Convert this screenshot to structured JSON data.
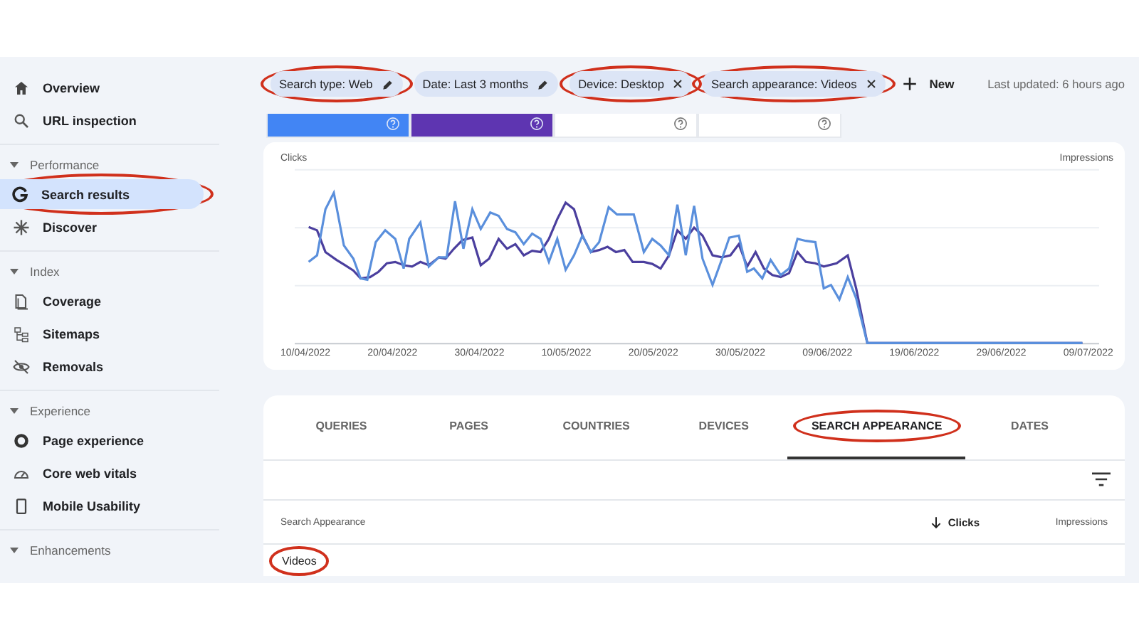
{
  "sidebar": {
    "top_items": [
      {
        "label": "Overview",
        "kind": "home",
        "selected": false,
        "circled": false
      },
      {
        "label": "URL inspection",
        "kind": "search",
        "selected": false,
        "circled": false
      }
    ],
    "sections": [
      {
        "title": "Performance",
        "expanded": true,
        "items": [
          {
            "label": "Search results",
            "kind": "google",
            "selected": true,
            "circled": true
          },
          {
            "label": "Discover",
            "kind": "asterisk",
            "selected": false,
            "circled": false
          }
        ]
      },
      {
        "title": "Index",
        "expanded": true,
        "items": [
          {
            "label": "Coverage",
            "kind": "pages",
            "selected": false,
            "circled": false
          },
          {
            "label": "Sitemaps",
            "kind": "sitemap",
            "selected": false,
            "circled": false
          },
          {
            "label": "Removals",
            "kind": "eyeoff",
            "selected": false,
            "circled": false
          }
        ]
      },
      {
        "title": "Experience",
        "expanded": true,
        "items": [
          {
            "label": "Page experience",
            "kind": "ring",
            "selected": false,
            "circled": false
          },
          {
            "label": "Core web vitals",
            "kind": "gauge",
            "selected": false,
            "circled": false
          },
          {
            "label": "Mobile Usability",
            "kind": "phone",
            "selected": false,
            "circled": false
          }
        ]
      },
      {
        "title": "Enhancements",
        "expanded": true
      }
    ]
  },
  "filters": {
    "chips": [
      {
        "label": "Search type: Web",
        "kind": "edit",
        "circled": true
      },
      {
        "label": "Date: Last 3 months",
        "kind": "edit",
        "circled": false
      },
      {
        "label": "Device: Desktop",
        "kind": "remove",
        "circled": true
      },
      {
        "label": "Search appearance: Videos",
        "kind": "remove",
        "circled": true
      }
    ],
    "new_button": "New",
    "last_updated": "Last updated: 6 hours ago"
  },
  "metric_cards": [
    {
      "selected": true,
      "color": "#4285f4"
    },
    {
      "selected": true,
      "color": "#5e35b1"
    },
    {
      "selected": false
    },
    {
      "selected": false
    }
  ],
  "chart": {
    "left_label": "Clicks",
    "right_label": "Impressions",
    "x_labels": [
      "10/04/2022",
      "20/04/2022",
      "30/04/2022",
      "10/05/2022",
      "20/05/2022",
      "30/05/2022",
      "09/06/2022",
      "19/06/2022",
      "29/06/2022",
      "09/07/2022"
    ]
  },
  "table": {
    "tabs": [
      {
        "label": "QUERIES",
        "selected": false,
        "circled": false
      },
      {
        "label": "PAGES",
        "selected": false,
        "circled": false
      },
      {
        "label": "COUNTRIES",
        "selected": false,
        "circled": false
      },
      {
        "label": "DEVICES",
        "selected": false,
        "circled": false
      },
      {
        "label": "SEARCH APPEARANCE",
        "selected": true,
        "circled": true
      },
      {
        "label": "DATES",
        "selected": false,
        "circled": false
      }
    ],
    "columns": [
      {
        "label": "Search Appearance",
        "sorted": false
      },
      {
        "label": "Clicks",
        "sorted": true
      },
      {
        "label": "Impressions",
        "sorted": false
      }
    ],
    "rows": [
      {
        "cells": [
          "Videos"
        ],
        "circled": true
      }
    ]
  }
}
